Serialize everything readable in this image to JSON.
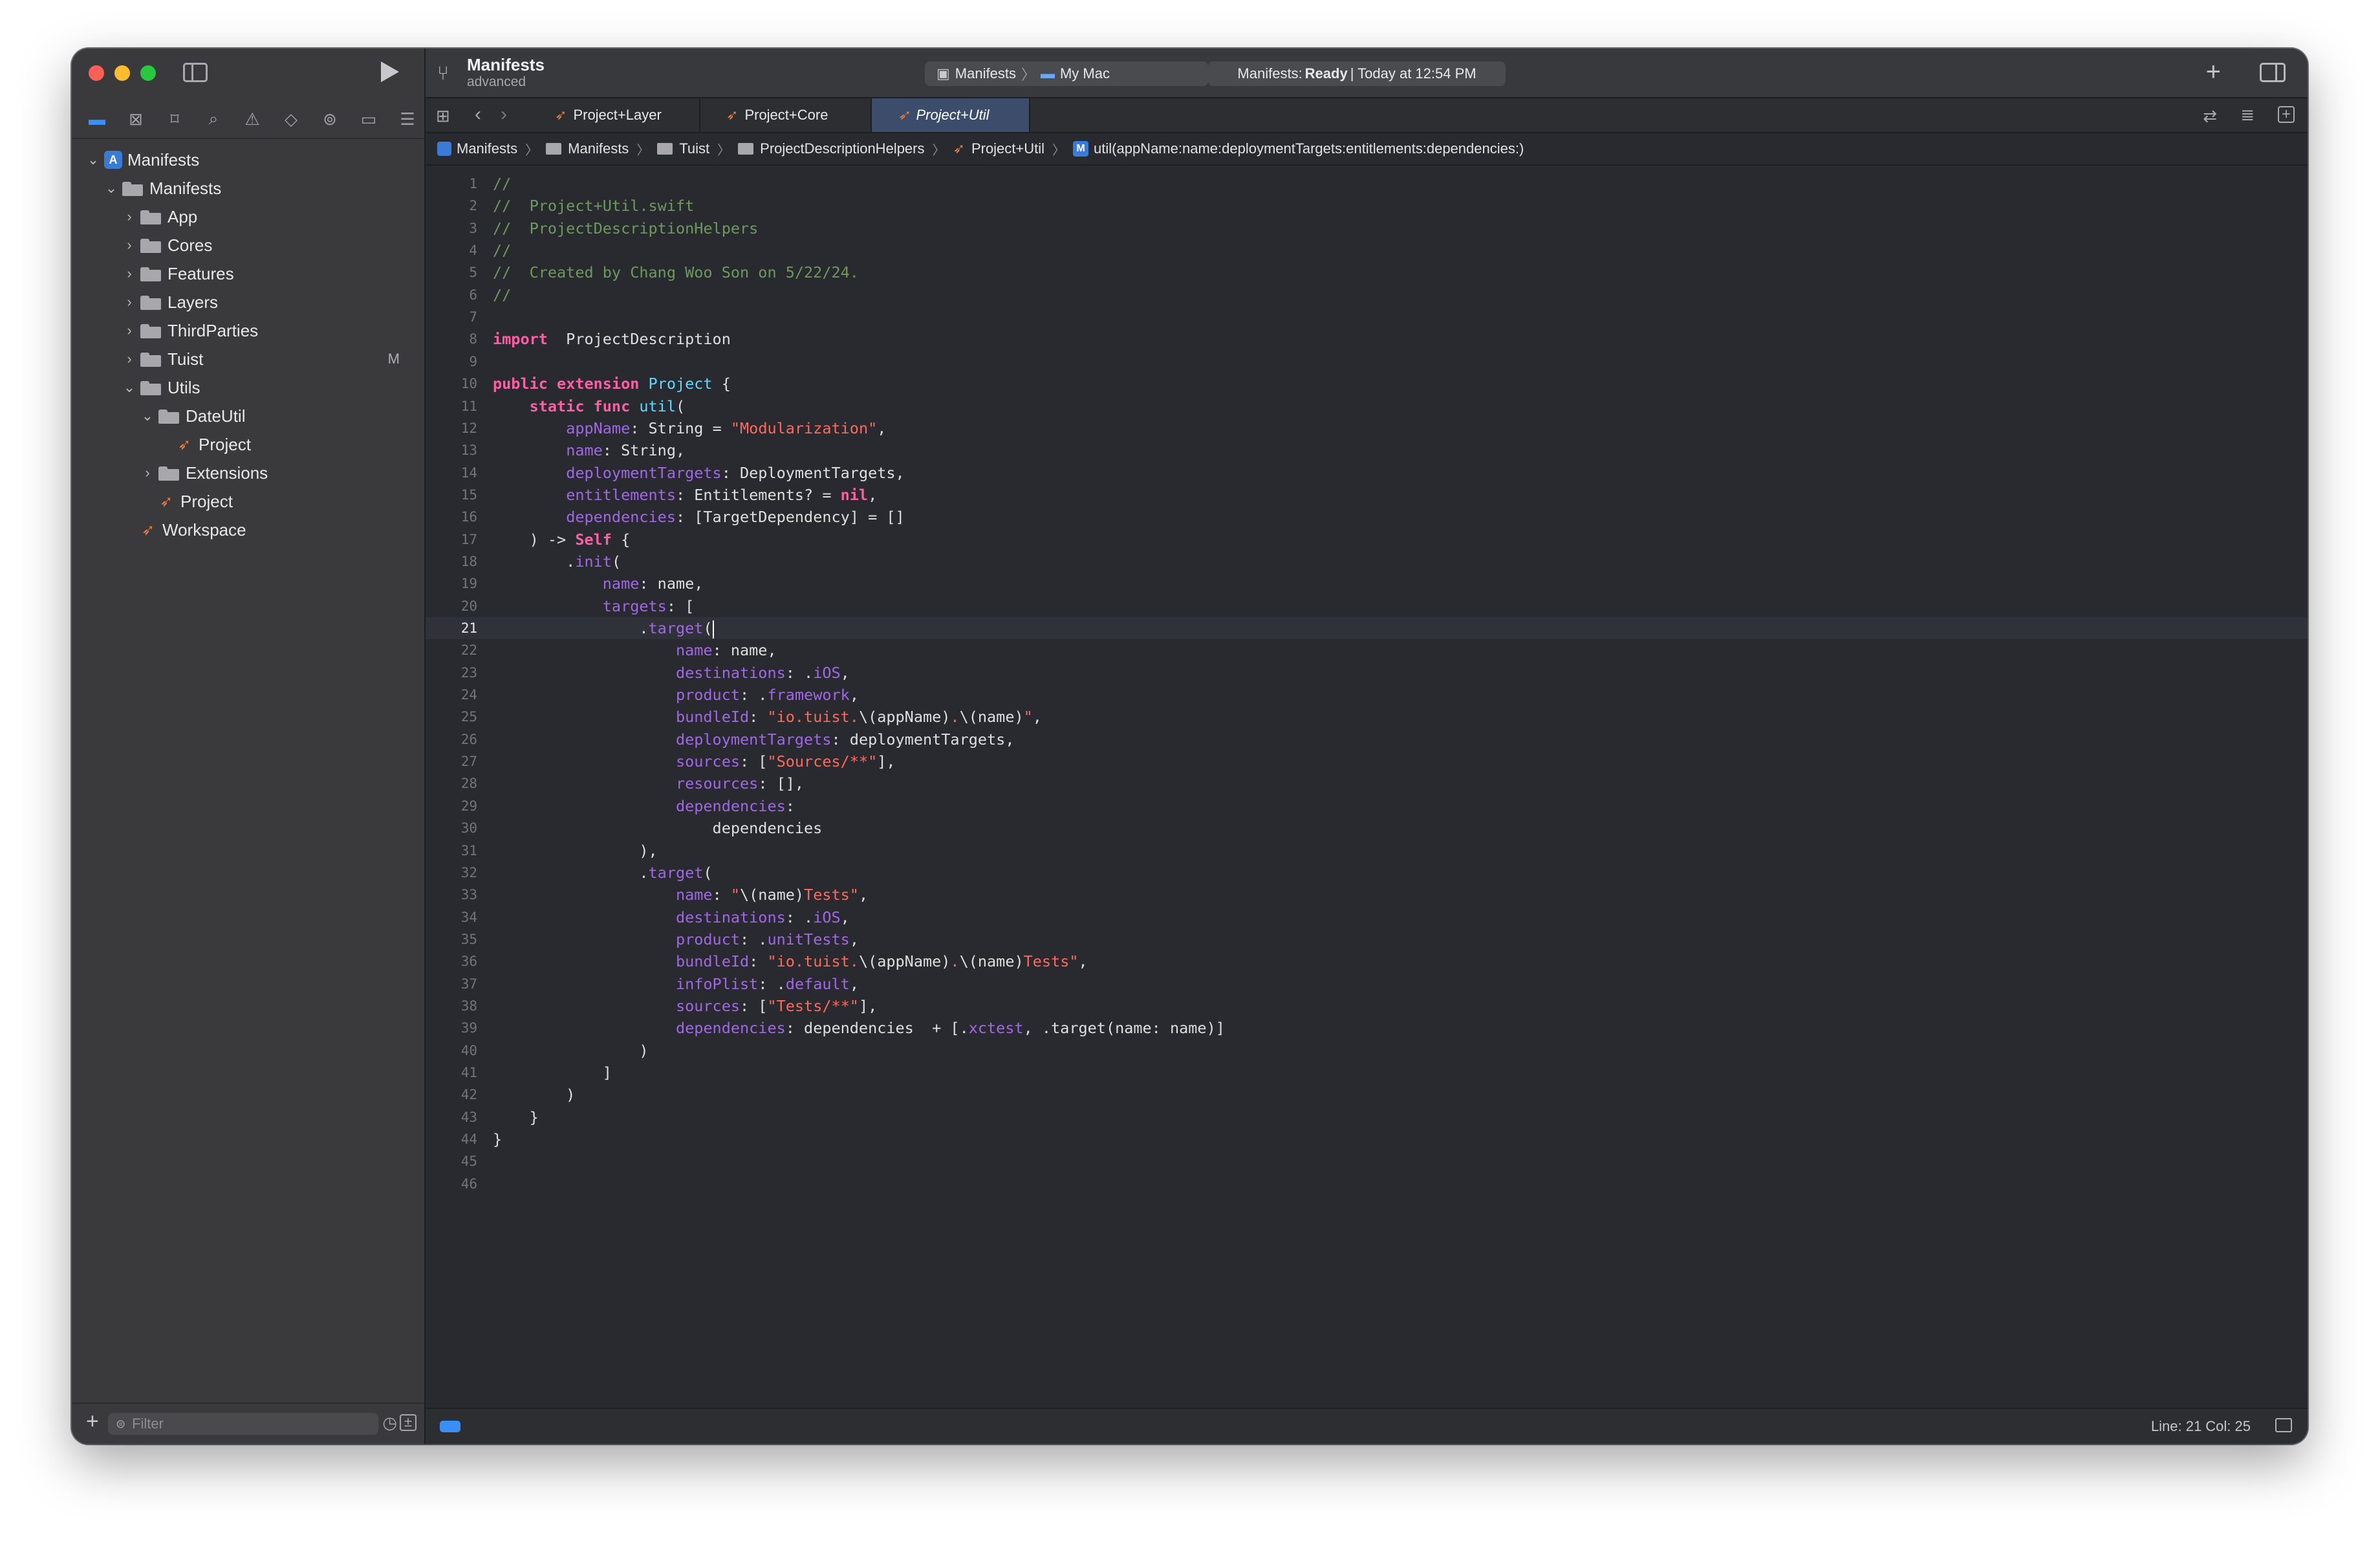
{
  "window": {
    "project_title": "Manifests",
    "project_subtitle": "advanced",
    "scheme_name": "Manifests",
    "scheme_sep": "〉",
    "destination": "My Mac",
    "status_prefix": "Manifests:",
    "status_state": "Ready",
    "status_time": "| Today at 12:54 PM"
  },
  "sidebar": {
    "tree": [
      {
        "label": "Manifests",
        "level": 0,
        "kind": "project",
        "chevron": "open"
      },
      {
        "label": "Manifests",
        "level": 1,
        "kind": "folder",
        "chevron": "open"
      },
      {
        "label": "App",
        "level": 2,
        "kind": "folder",
        "chevron": "closed"
      },
      {
        "label": "Cores",
        "level": 2,
        "kind": "folder",
        "chevron": "closed"
      },
      {
        "label": "Features",
        "level": 2,
        "kind": "folder",
        "chevron": "closed"
      },
      {
        "label": "Layers",
        "level": 2,
        "kind": "folder",
        "chevron": "closed"
      },
      {
        "label": "ThirdParties",
        "level": 2,
        "kind": "folder",
        "chevron": "closed"
      },
      {
        "label": "Tuist",
        "level": 2,
        "kind": "folder",
        "chevron": "closed",
        "badge": "M"
      },
      {
        "label": "Utils",
        "level": 2,
        "kind": "folder",
        "chevron": "open"
      },
      {
        "label": "DateUtil",
        "level": 3,
        "kind": "folder",
        "chevron": "open"
      },
      {
        "label": "Project",
        "level": 4,
        "kind": "swift",
        "chevron": "none"
      },
      {
        "label": "Extensions",
        "level": 3,
        "kind": "folder",
        "chevron": "closed"
      },
      {
        "label": "Project",
        "level": 3,
        "kind": "swift",
        "chevron": "none"
      },
      {
        "label": "Workspace",
        "level": 2,
        "kind": "swift",
        "chevron": "none"
      }
    ],
    "filter_placeholder": "Filter"
  },
  "tabs": [
    {
      "label": "Project+Layer",
      "active": false
    },
    {
      "label": "Project+Core",
      "active": false
    },
    {
      "label": "Project+Util",
      "active": true
    }
  ],
  "jumpbar": [
    {
      "label": "Manifests",
      "icon": "project"
    },
    {
      "label": "Manifests",
      "icon": "folder"
    },
    {
      "label": "Tuist",
      "icon": "folder"
    },
    {
      "label": "ProjectDescriptionHelpers",
      "icon": "folder"
    },
    {
      "label": "Project+Util",
      "icon": "swift"
    },
    {
      "label": "util(appName:name:deploymentTargets:entitlements:dependencies:)",
      "icon": "method"
    }
  ],
  "editor": {
    "current_line": 21,
    "lines": [
      [
        [
          "cm",
          "//"
        ]
      ],
      [
        [
          "cm",
          "//  Project+Util.swift"
        ]
      ],
      [
        [
          "cm",
          "//  ProjectDescriptionHelpers"
        ]
      ],
      [
        [
          "cm",
          "//"
        ]
      ],
      [
        [
          "cm",
          "//  Created by Chang Woo Son on 5/22/24."
        ]
      ],
      [
        [
          "cm",
          "//"
        ]
      ],
      [],
      [
        [
          "kw",
          "import"
        ],
        [
          "",
          "  ProjectDescription"
        ]
      ],
      [],
      [
        [
          "kw",
          "public"
        ],
        [
          "",
          " "
        ],
        [
          "kw",
          "extension"
        ],
        [
          "",
          " "
        ],
        [
          "ty",
          "Project"
        ],
        [
          "",
          " {"
        ]
      ],
      [
        [
          "",
          "    "
        ],
        [
          "kw",
          "static"
        ],
        [
          "",
          " "
        ],
        [
          "kw",
          "func"
        ],
        [
          "",
          " "
        ],
        [
          "ty",
          "util"
        ],
        [
          "",
          "("
        ]
      ],
      [
        [
          "",
          "        "
        ],
        [
          "pr",
          "appName"
        ],
        [
          "",
          ": String = "
        ],
        [
          "st",
          "\"Modularization\""
        ],
        [
          "",
          ","
        ]
      ],
      [
        [
          "",
          "        "
        ],
        [
          "pr",
          "name"
        ],
        [
          "",
          ": String,"
        ]
      ],
      [
        [
          "",
          "        "
        ],
        [
          "pr",
          "deploymentTargets"
        ],
        [
          "",
          ": DeploymentTargets,"
        ]
      ],
      [
        [
          "",
          "        "
        ],
        [
          "pr",
          "entitlements"
        ],
        [
          "",
          ": Entitlements? = "
        ],
        [
          "kw",
          "nil"
        ],
        [
          "",
          ","
        ]
      ],
      [
        [
          "",
          "        "
        ],
        [
          "pr",
          "dependencies"
        ],
        [
          "",
          ": [TargetDependency] = []"
        ]
      ],
      [
        [
          "",
          "    ) -> "
        ],
        [
          "kw",
          "Self"
        ],
        [
          "",
          " {"
        ]
      ],
      [
        [
          "",
          "        ."
        ],
        [
          "pr",
          "init"
        ],
        [
          "",
          "("
        ]
      ],
      [
        [
          "",
          "            "
        ],
        [
          "pr",
          "name"
        ],
        [
          "",
          ": name,"
        ]
      ],
      [
        [
          "",
          "            "
        ],
        [
          "pr",
          "targets"
        ],
        [
          "",
          ": ["
        ]
      ],
      [
        [
          "",
          "                ."
        ],
        [
          "pr",
          "target"
        ],
        [
          "",
          "("
        ],
        [
          "cur",
          ""
        ]
      ],
      [
        [
          "",
          "                    "
        ],
        [
          "pr",
          "name"
        ],
        [
          "",
          ": name,"
        ]
      ],
      [
        [
          "",
          "                    "
        ],
        [
          "pr",
          "destinations"
        ],
        [
          "",
          ": ."
        ],
        [
          "pr",
          "iOS"
        ],
        [
          "",
          ","
        ]
      ],
      [
        [
          "",
          "                    "
        ],
        [
          "pr",
          "product"
        ],
        [
          "",
          ": ."
        ],
        [
          "pr",
          "framework"
        ],
        [
          "",
          ","
        ]
      ],
      [
        [
          "",
          "                    "
        ],
        [
          "pr",
          "bundleId"
        ],
        [
          "",
          ": "
        ],
        [
          "st",
          "\"io.tuist."
        ],
        [
          "",
          "\\(appName)"
        ],
        [
          "st",
          "."
        ],
        [
          "",
          "\\(name)"
        ],
        [
          "st",
          "\""
        ],
        [
          "",
          ","
        ]
      ],
      [
        [
          "",
          "                    "
        ],
        [
          "pr",
          "deploymentTargets"
        ],
        [
          "",
          ": deploymentTargets,"
        ]
      ],
      [
        [
          "",
          "                    "
        ],
        [
          "pr",
          "sources"
        ],
        [
          "",
          ": ["
        ],
        [
          "st",
          "\"Sources/**\""
        ],
        [
          "",
          "],"
        ]
      ],
      [
        [
          "",
          "                    "
        ],
        [
          "pr",
          "resources"
        ],
        [
          "",
          ": [],"
        ]
      ],
      [
        [
          "",
          "                    "
        ],
        [
          "pr",
          "dependencies"
        ],
        [
          "",
          ":"
        ]
      ],
      [
        [
          "",
          "                        dependencies"
        ]
      ],
      [
        [
          "",
          "                ),"
        ]
      ],
      [
        [
          "",
          "                ."
        ],
        [
          "pr",
          "target"
        ],
        [
          "",
          "("
        ]
      ],
      [
        [
          "",
          "                    "
        ],
        [
          "pr",
          "name"
        ],
        [
          "",
          ": "
        ],
        [
          "st",
          "\""
        ],
        [
          "",
          "\\(name)"
        ],
        [
          "st",
          "Tests\""
        ],
        [
          "",
          ","
        ]
      ],
      [
        [
          "",
          "                    "
        ],
        [
          "pr",
          "destinations"
        ],
        [
          "",
          ": ."
        ],
        [
          "pr",
          "iOS"
        ],
        [
          "",
          ","
        ]
      ],
      [
        [
          "",
          "                    "
        ],
        [
          "pr",
          "product"
        ],
        [
          "",
          ": ."
        ],
        [
          "pr",
          "unitTests"
        ],
        [
          "",
          ","
        ]
      ],
      [
        [
          "",
          "                    "
        ],
        [
          "pr",
          "bundleId"
        ],
        [
          "",
          ": "
        ],
        [
          "st",
          "\"io.tuist."
        ],
        [
          "",
          "\\(appName)"
        ],
        [
          "st",
          "."
        ],
        [
          "",
          "\\(name)"
        ],
        [
          "st",
          "Tests\""
        ],
        [
          "",
          ","
        ]
      ],
      [
        [
          "",
          "                    "
        ],
        [
          "pr",
          "infoPlist"
        ],
        [
          "",
          ": ."
        ],
        [
          "pr",
          "default"
        ],
        [
          "",
          ","
        ]
      ],
      [
        [
          "",
          "                    "
        ],
        [
          "pr",
          "sources"
        ],
        [
          "",
          ": ["
        ],
        [
          "st",
          "\"Tests/**\""
        ],
        [
          "",
          "],"
        ]
      ],
      [
        [
          "",
          "                    "
        ],
        [
          "pr",
          "dependencies"
        ],
        [
          "",
          ": dependencies  + [."
        ],
        [
          "pr",
          "xctest"
        ],
        [
          "",
          ", .target(name: name)]"
        ]
      ],
      [
        [
          "",
          "                )"
        ]
      ],
      [
        [
          "",
          "            ]"
        ]
      ],
      [
        [
          "",
          "        )"
        ]
      ],
      [
        [
          "",
          "    }"
        ]
      ],
      [
        [
          "",
          "}"
        ]
      ],
      [],
      []
    ]
  },
  "statusbar": {
    "position": "Line: 21  Col: 25"
  }
}
